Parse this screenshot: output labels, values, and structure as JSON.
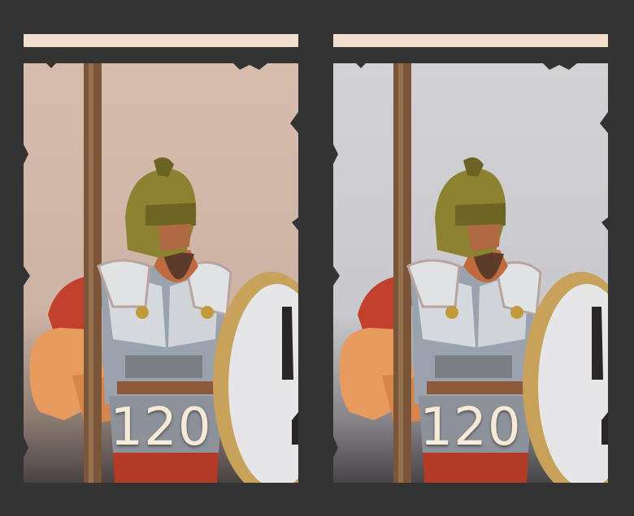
{
  "cards": [
    {
      "id": "left",
      "cost": "120",
      "background_color": "#d3b8a8",
      "banner_color": "#f2dfcd"
    },
    {
      "id": "right",
      "cost": "120",
      "background_color": "#cfcfd3",
      "banner_color": "#f2dfcd"
    }
  ],
  "portrait_subject": "hoplite-soldier-portrait"
}
